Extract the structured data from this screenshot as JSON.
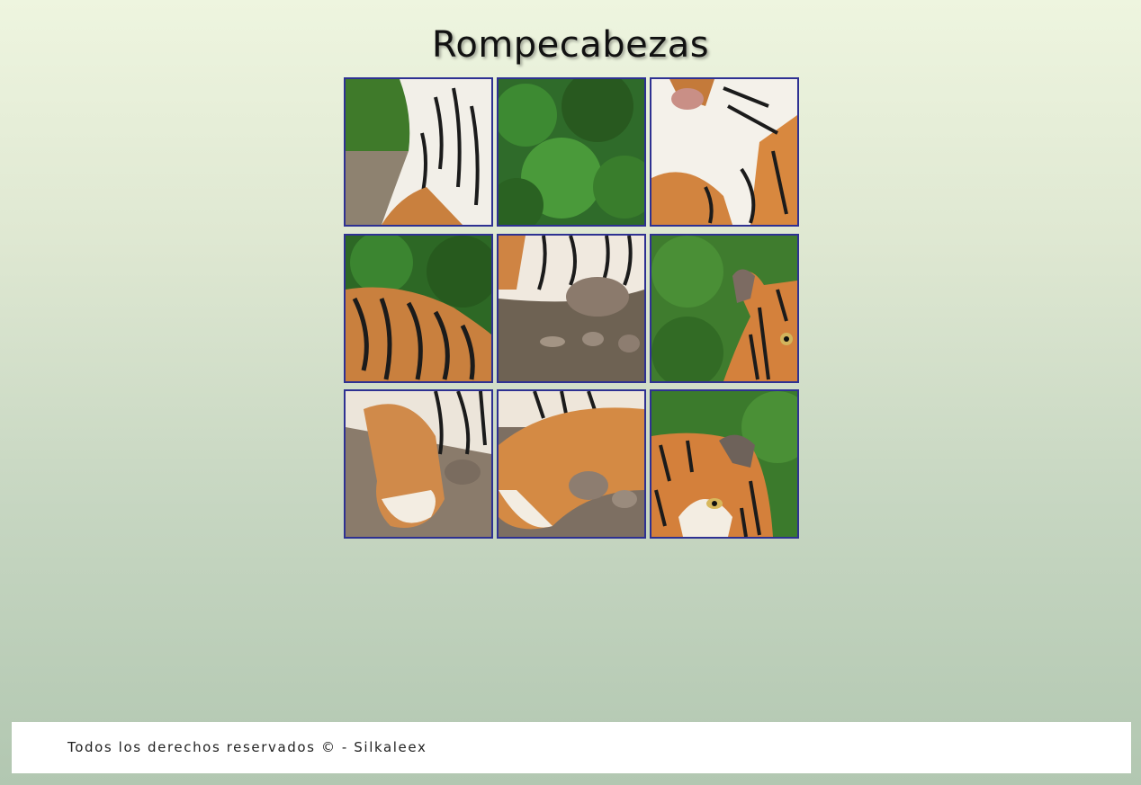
{
  "page": {
    "title": "Rompecabezas"
  },
  "puzzle": {
    "grid": "3x3",
    "image_subject": "tiger",
    "tile_border_color": "#2e3192",
    "tiles": [
      {
        "id": "tile-1",
        "content": "tiger-side-and-grass"
      },
      {
        "id": "tile-2",
        "content": "green-foliage"
      },
      {
        "id": "tile-3",
        "content": "tiger-nose-and-chest"
      },
      {
        "id": "tile-4",
        "content": "tiger-back-and-foliage"
      },
      {
        "id": "tile-5",
        "content": "tiger-belly-and-rocks"
      },
      {
        "id": "tile-6",
        "content": "tiger-right-ear-and-eye"
      },
      {
        "id": "tile-7",
        "content": "tiger-left-paw"
      },
      {
        "id": "tile-8",
        "content": "tiger-right-paw"
      },
      {
        "id": "tile-9",
        "content": "tiger-face-and-ear"
      }
    ]
  },
  "footer": {
    "text": "Todos los derechos reservados © - Silkaleex"
  },
  "colors": {
    "background_top": "#eef5df",
    "background_bottom": "#b2c7b1",
    "footer_background": "#ffffff"
  }
}
